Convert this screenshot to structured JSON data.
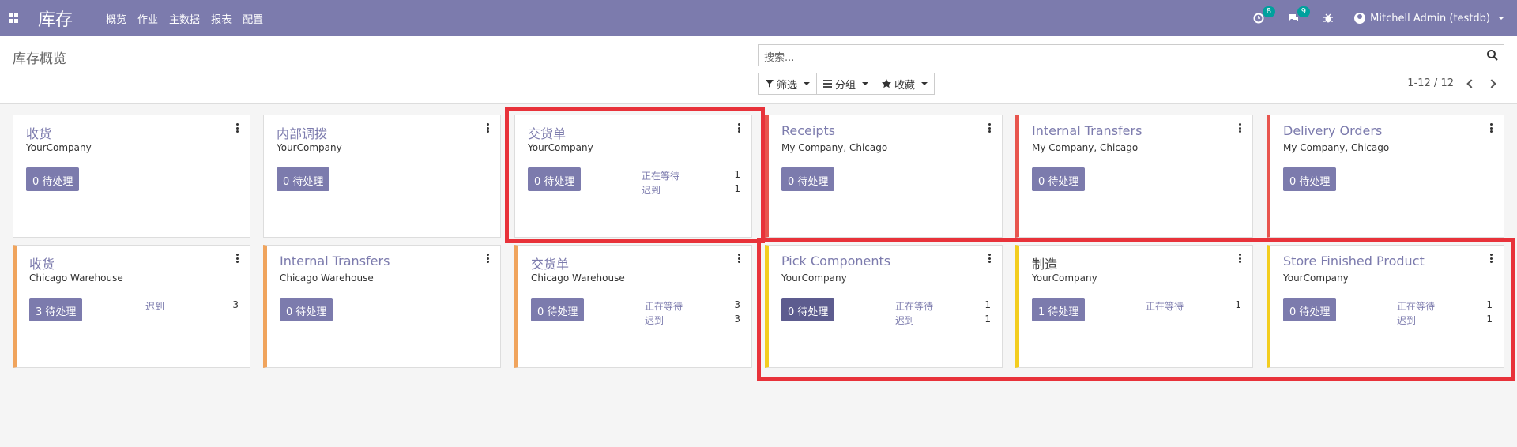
{
  "app": {
    "brand": "库存",
    "menu": [
      "概览",
      "作业",
      "主数据",
      "报表",
      "配置"
    ],
    "activity_badge": "8",
    "message_badge": "9",
    "user": "Mitchell Admin (testdb)"
  },
  "control_panel": {
    "title": "库存概览",
    "search_placeholder": "搜索...",
    "filters_label": "筛选",
    "groupby_label": "分组",
    "favorites_label": "收藏",
    "pager": "1-12 / 12"
  },
  "cards": [
    {
      "title": "收货",
      "sub": "YourCompany",
      "btn": "0 待处理",
      "stats": []
    },
    {
      "title": "内部调拨",
      "sub": "YourCompany",
      "btn": "0 待处理",
      "stats": []
    },
    {
      "title": "交货单",
      "sub": "YourCompany",
      "btn": "0 待处理",
      "stats": [
        {
          "label": "正在等待",
          "value": "1"
        },
        {
          "label": "迟到",
          "value": "1"
        }
      ]
    },
    {
      "title": "Receipts",
      "sub": "My Company, Chicago",
      "btn": "0 待处理",
      "stats": []
    },
    {
      "title": "Internal Transfers",
      "sub": "My Company, Chicago",
      "btn": "0 待处理",
      "stats": []
    },
    {
      "title": "Delivery Orders",
      "sub": "My Company, Chicago",
      "btn": "0 待处理",
      "stats": []
    },
    {
      "title": "收货",
      "sub": "Chicago Warehouse",
      "btn": "3 待处理",
      "stats": [
        {
          "label": "迟到",
          "value": "3"
        }
      ]
    },
    {
      "title": "Internal Transfers",
      "sub": "Chicago Warehouse",
      "btn": "0 待处理",
      "stats": []
    },
    {
      "title": "交货单",
      "sub": "Chicago Warehouse",
      "btn": "0 待处理",
      "stats": [
        {
          "label": "正在等待",
          "value": "3"
        },
        {
          "label": "迟到",
          "value": "3"
        }
      ]
    },
    {
      "title": "Pick Components",
      "sub": "YourCompany",
      "btn": "0 待处理",
      "stats": [
        {
          "label": "正在等待",
          "value": "1"
        },
        {
          "label": "迟到",
          "value": "1"
        }
      ]
    },
    {
      "title": "制造",
      "sub": "YourCompany",
      "btn": "1 待处理",
      "stats": [
        {
          "label": "正在等待",
          "value": "1"
        }
      ]
    },
    {
      "title": "Store Finished Product",
      "sub": "YourCompany",
      "btn": "0 待处理",
      "stats": [
        {
          "label": "正在等待",
          "value": "1"
        },
        {
          "label": "迟到",
          "value": "1"
        }
      ]
    }
  ],
  "colors": {
    "brand": "#7c7bad",
    "red_bar": "#e8554e",
    "orange_bar": "#f0a45d",
    "yellow_bar": "#f3cd1f",
    "highlight": "#e8323a"
  }
}
